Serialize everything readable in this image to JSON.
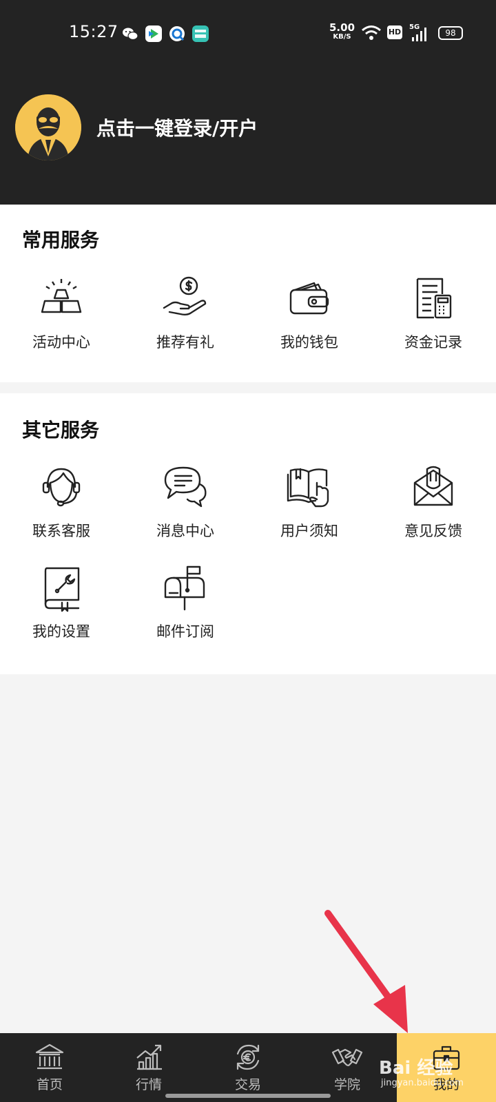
{
  "status_bar": {
    "time": "15:27",
    "net_speed": "5.00",
    "net_unit": "KB/S",
    "hd": "HD",
    "signal": "5G",
    "battery": "98"
  },
  "header": {
    "login_text": "点击一键登录/开户"
  },
  "common_services": {
    "title": "常用服务",
    "items": [
      {
        "label": "活动中心",
        "icon": "gold-bars-icon"
      },
      {
        "label": "推荐有礼",
        "icon": "hand-coin-icon"
      },
      {
        "label": "我的钱包",
        "icon": "wallet-icon"
      },
      {
        "label": "资金记录",
        "icon": "ledger-calculator-icon"
      }
    ]
  },
  "other_services": {
    "title": "其它服务",
    "items": [
      {
        "label": "联系客服",
        "icon": "headset-agent-icon"
      },
      {
        "label": "消息中心",
        "icon": "chat-bubbles-icon"
      },
      {
        "label": "用户须知",
        "icon": "book-hand-icon"
      },
      {
        "label": "意见反馈",
        "icon": "envelope-feedback-icon"
      },
      {
        "label": "我的设置",
        "icon": "settings-book-icon"
      },
      {
        "label": "邮件订阅",
        "icon": "mailbox-icon"
      }
    ]
  },
  "bottom_nav": {
    "items": [
      {
        "label": "首页",
        "icon": "bank-icon"
      },
      {
        "label": "行情",
        "icon": "chart-up-icon"
      },
      {
        "label": "交易",
        "icon": "currency-exchange-icon"
      },
      {
        "label": "学院",
        "icon": "handshake-icon"
      },
      {
        "label": "我的",
        "icon": "briefcase-icon"
      }
    ],
    "active_index": 4
  },
  "watermark": {
    "text": "Bai 经验",
    "url": "jingyan.baidu.com"
  },
  "colors": {
    "dark": "#232323",
    "accent": "#fdd267",
    "avatar_bg": "#f5c453",
    "arrow": "#e8344a"
  }
}
